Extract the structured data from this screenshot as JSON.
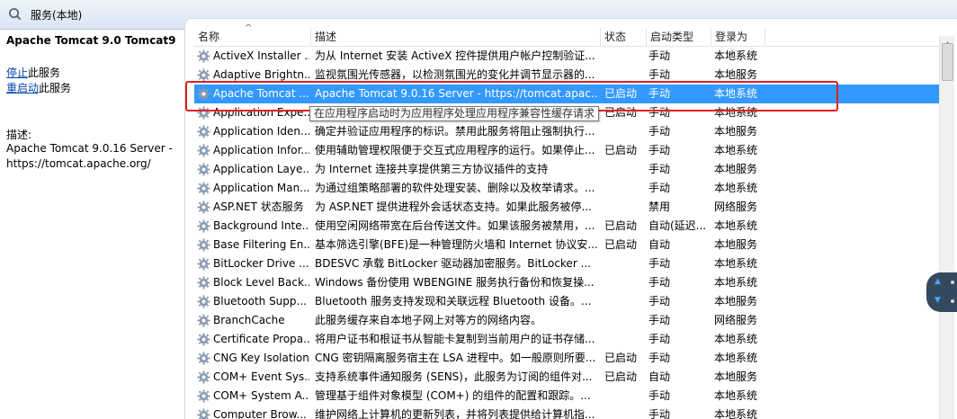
{
  "window": {
    "title": "服务(本地)",
    "icon": "services-icon"
  },
  "left_panel": {
    "service_title": "Apache Tomcat 9.0 Tomcat9",
    "stop_link": "停止",
    "stop_suffix": "此服务",
    "restart_link": "重启动",
    "restart_suffix": "此服务",
    "description_label": "描述:",
    "description_text": "Apache Tomcat 9.0.16 Server - https://tomcat.apache.org/"
  },
  "table": {
    "columns": [
      "名称",
      "描述",
      "状态",
      "启动类型",
      "登录为"
    ],
    "sort_column": "名称",
    "selected_index": 2,
    "rows": [
      {
        "name": "ActiveX Installer ...",
        "desc": "为从 Internet 安装 ActiveX 控件提供用户帐户控制验证...",
        "status": "",
        "start": "手动",
        "logon": "本地系统"
      },
      {
        "name": "Adaptive Brightn...",
        "desc": "监视氛围光传感器，以检测氛围光的变化并调节显示器的...",
        "status": "",
        "start": "手动",
        "logon": "本地服务"
      },
      {
        "name": "Apache Tomcat ...",
        "desc": "Apache Tomcat 9.0.16 Server - https://tomcat.apac...",
        "status": "已启动",
        "start": "手动",
        "logon": "本地系统"
      },
      {
        "name": "Application Expe...",
        "desc": "在应用程序启动时为应用程序处理应用程序兼容性缓存请求",
        "status": "已启动",
        "start": "手动",
        "logon": "本地系统"
      },
      {
        "name": "Application Iden...",
        "desc": "确定并验证应用程序的标识。禁用此服务将阻止强制执行...",
        "status": "",
        "start": "手动",
        "logon": "本地服务"
      },
      {
        "name": "Application Infor...",
        "desc": "使用辅助管理权限便于交互式应用程序的运行。如果停止...",
        "status": "已启动",
        "start": "手动",
        "logon": "本地系统"
      },
      {
        "name": "Application Laye...",
        "desc": "为 Internet 连接共享提供第三方协议插件的支持",
        "status": "",
        "start": "手动",
        "logon": "本地服务"
      },
      {
        "name": "Application Man...",
        "desc": "为通过组策略部署的软件处理安装、删除以及枚举请求。...",
        "status": "",
        "start": "手动",
        "logon": "本地系统"
      },
      {
        "name": "ASP.NET 状态服务",
        "desc": "为 ASP.NET 提供进程外会话状态支持。如果此服务被停...",
        "status": "",
        "start": "禁用",
        "logon": "网络服务"
      },
      {
        "name": "Background Inte...",
        "desc": "使用空闲网络带宽在后台传送文件。如果该服务被禁用，...",
        "status": "已启动",
        "start": "自动(延迟...",
        "logon": "本地系统"
      },
      {
        "name": "Base Filtering En...",
        "desc": "基本筛选引擎(BFE)是一种管理防火墙和 Internet 协议安...",
        "status": "已启动",
        "start": "自动",
        "logon": "本地服务"
      },
      {
        "name": "BitLocker Drive ...",
        "desc": "BDESVC 承载 BitLocker 驱动器加密服务。BitLocker ...",
        "status": "",
        "start": "手动",
        "logon": "本地系统"
      },
      {
        "name": "Block Level Back...",
        "desc": "Windows 备份使用 WBENGINE 服务执行备份和恢复操...",
        "status": "",
        "start": "手动",
        "logon": "本地系统"
      },
      {
        "name": "Bluetooth Supp...",
        "desc": "Bluetooth 服务支持发现和关联远程 Bluetooth 设备。...",
        "status": "",
        "start": "手动",
        "logon": "本地服务"
      },
      {
        "name": "BranchCache",
        "desc": "此服务缓存来自本地子网上对等方的网络内容。",
        "status": "",
        "start": "手动",
        "logon": "网络服务"
      },
      {
        "name": "Certificate Propa...",
        "desc": "将用户证书和根证书从智能卡复制到当前用户的证书存储...",
        "status": "",
        "start": "手动",
        "logon": "本地系统"
      },
      {
        "name": "CNG Key Isolation",
        "desc": "CNG 密钥隔离服务宿主在 LSA 进程中。如一般原则所要...",
        "status": "已启动",
        "start": "手动",
        "logon": "本地系统"
      },
      {
        "name": "COM+ Event Sys...",
        "desc": "支持系统事件通知服务 (SENS)，此服务为订阅的组件对...",
        "status": "已启动",
        "start": "自动",
        "logon": "本地服务"
      },
      {
        "name": "COM+ System A...",
        "desc": "管理基于组件对象模型 (COM+) 的组件的配置和跟踪。...",
        "status": "",
        "start": "手动",
        "logon": "本地系统"
      },
      {
        "name": "Computer Brow...",
        "desc": "维护网络上计算机的更新列表，并将列表提供给计算机指...",
        "status": "",
        "start": "手动",
        "logon": "本地系统"
      }
    ]
  },
  "tooltip": "在应用程序启动时为应用程序处理应用程序兼容性缓存请求",
  "colors": {
    "selection": "#3399ff",
    "highlight_box": "#e02020",
    "link": "#0645ad"
  }
}
